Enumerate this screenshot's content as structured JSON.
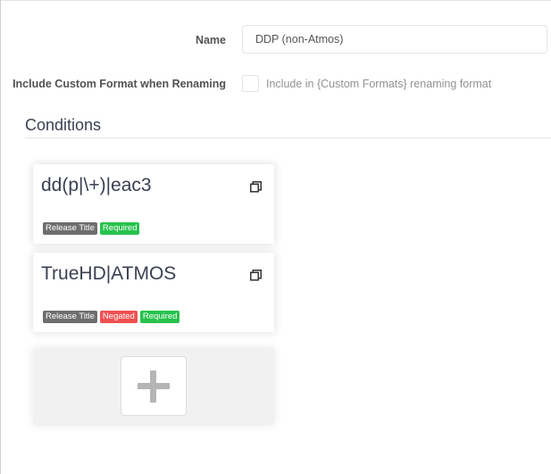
{
  "form": {
    "name_label": "Name",
    "name_value": "DDP (non-Atmos)",
    "include_label": "Include Custom Format when Renaming",
    "include_checked": false,
    "include_help": "Include in {Custom Formats} renaming format"
  },
  "conditions": {
    "title": "Conditions",
    "items": [
      {
        "name": "dd(p|\\+)|eac3",
        "icon": "clone-icon",
        "labels": [
          {
            "text": "Release Title",
            "kind": "default"
          },
          {
            "text": "Required",
            "kind": "success"
          }
        ]
      },
      {
        "name": "TrueHD|ATMOS",
        "icon": "clone-icon",
        "labels": [
          {
            "text": "Release Title",
            "kind": "default"
          },
          {
            "text": "Negated",
            "kind": "danger"
          },
          {
            "text": "Required",
            "kind": "success"
          }
        ]
      }
    ],
    "add_icon": "plus-icon"
  },
  "colors": {
    "default": "#6e6e6e",
    "danger": "#f05050",
    "success": "#27c24c"
  }
}
